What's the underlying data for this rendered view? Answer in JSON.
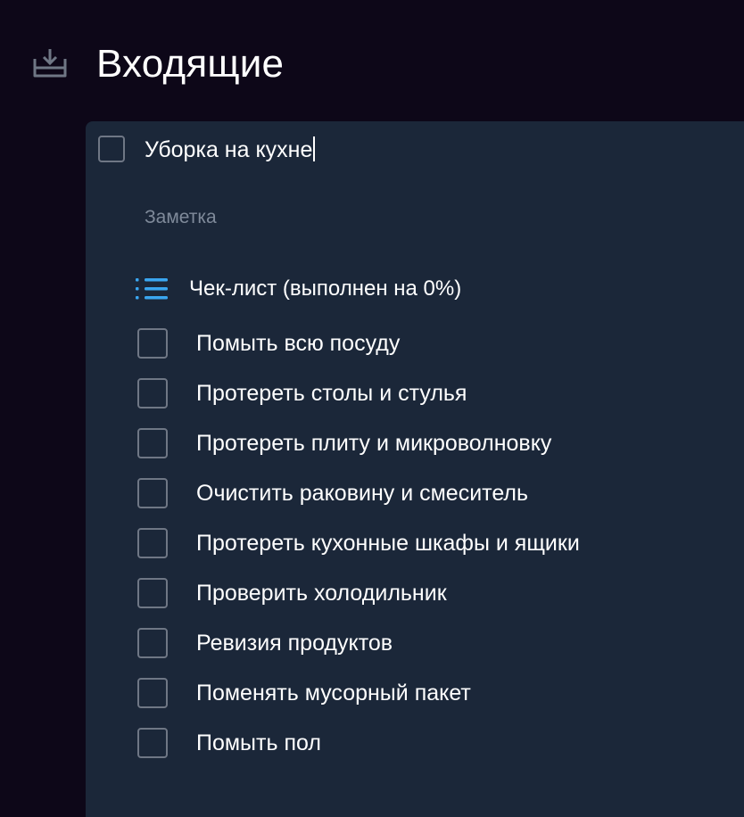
{
  "header": {
    "icon": "inbox-download-icon",
    "title": "Входящие"
  },
  "task": {
    "title": "Уборка на кухне",
    "note_placeholder": "Заметка",
    "checklist": {
      "icon": "list-icon",
      "title": "Чек-лист (выполнен на 0%)",
      "progress_percent": 0,
      "items": [
        {
          "label": "Помыть всю посуду",
          "checked": false
        },
        {
          "label": "Протереть столы и стулья",
          "checked": false
        },
        {
          "label": "Протереть плиту и микроволновку",
          "checked": false
        },
        {
          "label": "Очистить раковину и смеситель",
          "checked": false
        },
        {
          "label": "Протереть кухонные шкафы и ящики",
          "checked": false
        },
        {
          "label": "Проверить холодильник",
          "checked": false
        },
        {
          "label": "Ревизия продуктов",
          "checked": false
        },
        {
          "label": "Поменять мусорный пакет",
          "checked": false
        },
        {
          "label": "Помыть пол",
          "checked": false
        }
      ]
    }
  },
  "colors": {
    "background": "#0d0718",
    "card": "#1b2739",
    "checkbox_border": "#6f7785",
    "muted_text": "#7f8a9a",
    "accent": "#3aa6f0",
    "header_icon": "#6f7785"
  }
}
